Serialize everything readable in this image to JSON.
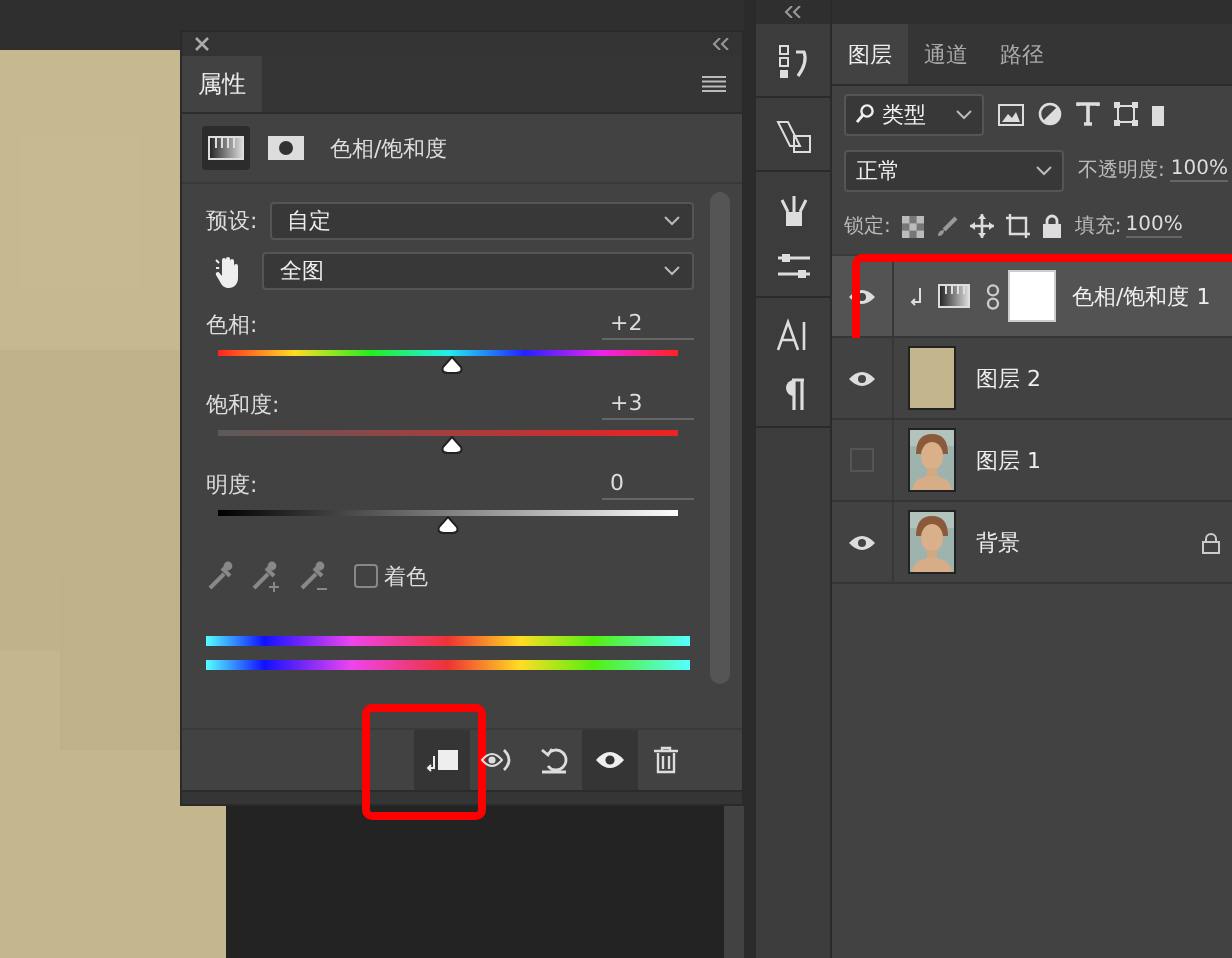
{
  "properties_panel": {
    "tab": "属性",
    "adjustment_title": "色相/饱和度",
    "preset_label": "预设:",
    "preset_value": "自定",
    "range_value": "全图",
    "sliders": [
      {
        "kind": "hue",
        "label": "色相:",
        "value": "+2",
        "level": 0.51
      },
      {
        "kind": "saturation",
        "label": "饱和度:",
        "value": "+3",
        "level": 0.51
      },
      {
        "kind": "lightness",
        "label": "明度:",
        "value": "0",
        "level": 0.5
      }
    ],
    "colorize": {
      "label": "着色",
      "checked": false
    },
    "footer_buttons": [
      {
        "kind": "clip",
        "selected": true,
        "highlighted": true
      },
      {
        "kind": "view-previous",
        "selected": false,
        "highlighted": false
      },
      {
        "kind": "reset",
        "selected": false,
        "highlighted": false
      },
      {
        "kind": "visibility",
        "selected": true,
        "highlighted": false
      },
      {
        "kind": "delete",
        "selected": false,
        "highlighted": false
      }
    ]
  },
  "layers_panel": {
    "tabs": [
      {
        "label": "图层",
        "selected": true
      },
      {
        "label": "通道",
        "selected": false
      },
      {
        "label": "路径",
        "selected": false
      }
    ],
    "filter": "类型",
    "blend_mode": "正常",
    "opacity_label": "不透明度:",
    "opacity": "100%",
    "lock_label": "锁定:",
    "fill_label": "填充:",
    "fill": "100%",
    "layers": [
      {
        "kind": "adjustment",
        "name": "色相/饱和度 1",
        "visible": true,
        "selected": true,
        "locked": false,
        "clipped": true,
        "highlighted": true
      },
      {
        "kind": "fill",
        "name": "图层 2",
        "visible": true,
        "selected": false,
        "locked": false,
        "clipped": false,
        "highlighted": false
      },
      {
        "name": "图层 1",
        "visible": false,
        "selected": false,
        "locked": false,
        "clipped": false,
        "highlighted": false
      },
      {
        "name": "背景",
        "visible": true,
        "selected": false,
        "locked": true,
        "clipped": false,
        "highlighted": false
      }
    ]
  }
}
